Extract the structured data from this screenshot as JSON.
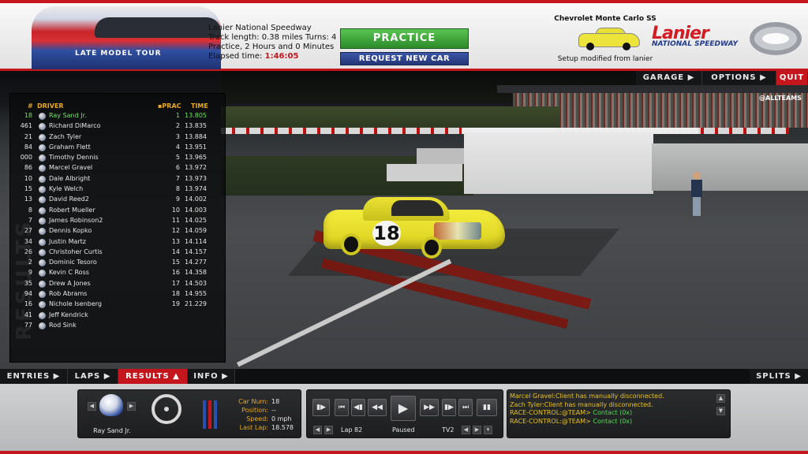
{
  "header": {
    "series_logo": "LATE MODEL TOUR",
    "track_name": "Lanier National Speedway",
    "track_length": "Track length: 0.38 miles Turns: 4",
    "session": "Practice, 2 Hours and 0 Minutes",
    "elapsed_label": "Elapsed time:",
    "elapsed_value": "1:46:05",
    "practice_button": "PRACTICE",
    "request_car_button": "REQUEST NEW CAR",
    "car_model": "Chevrolet Monte Carlo SS",
    "setup_note": "Setup modified from lanier",
    "track_logo_main": "Lanier",
    "track_logo_sub": "NATIONAL SPEEDWAY"
  },
  "nav": {
    "garage": "GARAGE ▶",
    "options": "OPTIONS ▶",
    "quit": "QUIT"
  },
  "scene": {
    "overlay_tag": "@ALLTEAMS",
    "car_number": "18"
  },
  "results": {
    "side_label": "RESULTS",
    "headers": {
      "num": "#",
      "driver": "DRIVER",
      "prac": "PRAC",
      "time": "TIME"
    },
    "rows": [
      {
        "num": "18",
        "driver": "Ray Sand Jr.",
        "pos": "1",
        "time": "13.805"
      },
      {
        "num": "461",
        "driver": "Richard DiMarco",
        "pos": "2",
        "time": "13.835"
      },
      {
        "num": "21",
        "driver": "Zach Tyler",
        "pos": "3",
        "time": "13.884"
      },
      {
        "num": "84",
        "driver": "Graham Flett",
        "pos": "4",
        "time": "13.951"
      },
      {
        "num": "000",
        "driver": "Timothy Dennis",
        "pos": "5",
        "time": "13.965"
      },
      {
        "num": "86",
        "driver": "Marcel Gravel",
        "pos": "6",
        "time": "13.972"
      },
      {
        "num": "10",
        "driver": "Dale Albright",
        "pos": "7",
        "time": "13.973"
      },
      {
        "num": "15",
        "driver": "Kyle Welch",
        "pos": "8",
        "time": "13.974"
      },
      {
        "num": "13",
        "driver": "David Reed2",
        "pos": "9",
        "time": "14.002"
      },
      {
        "num": "8",
        "driver": "Robert Mueller",
        "pos": "10",
        "time": "14.003"
      },
      {
        "num": "7",
        "driver": "James Robinson2",
        "pos": "11",
        "time": "14.025"
      },
      {
        "num": "27",
        "driver": "Dennis Kopko",
        "pos": "12",
        "time": "14.059"
      },
      {
        "num": "34",
        "driver": "Justin Martz",
        "pos": "13",
        "time": "14.114"
      },
      {
        "num": "26",
        "driver": "Christoher Curtis",
        "pos": "14",
        "time": "14.157"
      },
      {
        "num": "2",
        "driver": "Dominic Tesoro",
        "pos": "15",
        "time": "14.277"
      },
      {
        "num": "9",
        "driver": "Kevin C Ross",
        "pos": "16",
        "time": "14.358"
      },
      {
        "num": "35",
        "driver": "Drew A Jones",
        "pos": "17",
        "time": "14.503"
      },
      {
        "num": "94",
        "driver": "Rob Abrams",
        "pos": "18",
        "time": "14.955"
      },
      {
        "num": "16",
        "driver": "Nichole Isenberg",
        "pos": "19",
        "time": "21.229"
      },
      {
        "num": "41",
        "driver": "Jeff Kendrick",
        "pos": "",
        "time": ""
      },
      {
        "num": "77",
        "driver": "Rod Sink",
        "pos": "",
        "time": ""
      }
    ]
  },
  "tabs": {
    "entries": "ENTRIES ▶",
    "laps": "LAPS ▶",
    "results": "RESULTS ▲",
    "info": "INFO ▶",
    "splits": "SPLITS ▶"
  },
  "dock": {
    "driver_name": "Ray Sand Jr.",
    "car_num_label": "Car Num:",
    "car_num": "18",
    "position_label": "Position:",
    "position": "--",
    "speed_label": "Speed:",
    "speed": "0 mph",
    "last_lap_label": "Last Lap:",
    "last_lap": "18.578",
    "lap_label": "Lap 82",
    "status": "Paused",
    "camera": "TV2",
    "chat": [
      {
        "text": "Marcel Gravel:Client has manually disconnected.",
        "color": "yellow"
      },
      {
        "text": "Zach Tyler:Client has manually disconnected.",
        "color": "yellow"
      },
      {
        "prefix": "RACE-CONTROL:@TEAM>",
        "text": " Contact (0x)"
      },
      {
        "prefix": "RACE-CONTROL:@TEAM>",
        "text": " Contact (0x)"
      }
    ]
  },
  "colors": {
    "accent_red": "#c4161c",
    "practice_green": "#2b8a2a",
    "request_blue": "#233675",
    "header_amber": "#e8a91e",
    "highlight_green": "#6fe35c"
  }
}
